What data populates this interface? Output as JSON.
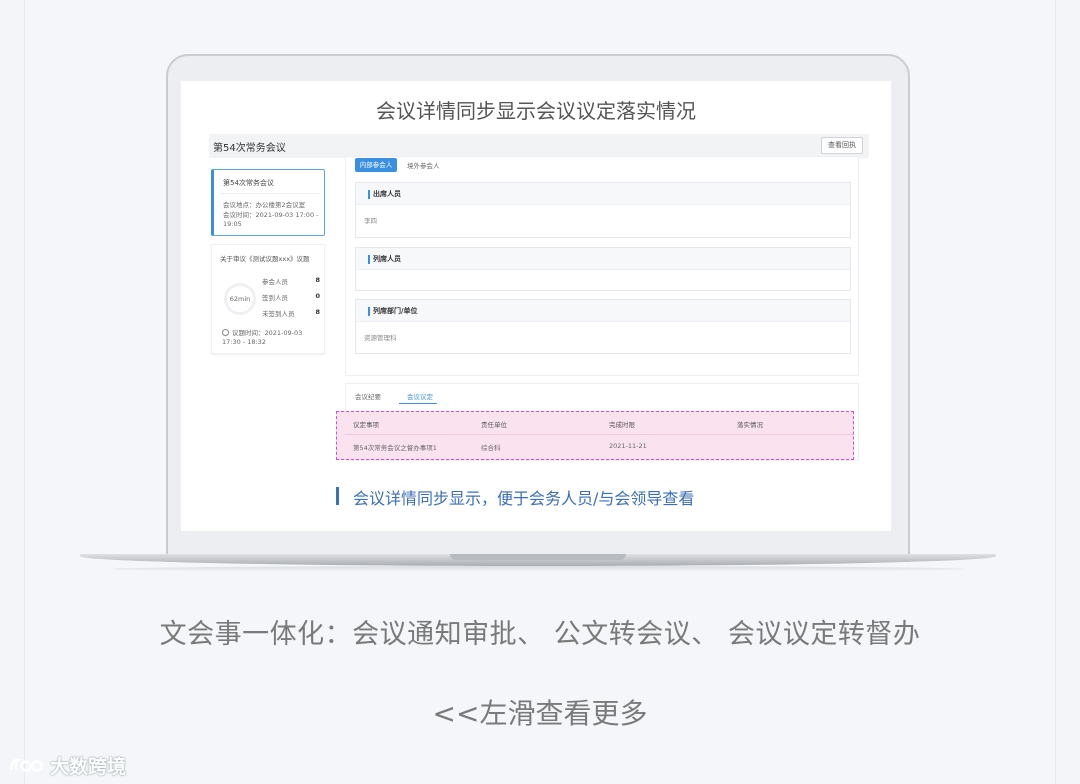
{
  "screen": {
    "title": "会议详情同步显示会议议定落实情况",
    "meeting_name": "第54次常务会议",
    "receipt_button": "查看回执",
    "info_card": {
      "title": "第54次常务会议",
      "location": "会议地点：办公楼第2会议室",
      "time": "会议时间：2021-09-03 17:00 - 19:05"
    },
    "topic_card": {
      "title": "关于审议《测试议题xxx》议题",
      "duration": "62min",
      "stats": [
        {
          "label": "参会人员",
          "value": "8"
        },
        {
          "label": "签到人员",
          "value": "0"
        },
        {
          "label": "未签到人员",
          "value": "8"
        }
      ],
      "vote_time": "议题时间：2021-09-03 17:30 - 18:32"
    },
    "tabs": {
      "active": "内部参会人",
      "inactive": "境外参会人"
    },
    "sections": [
      {
        "title": "出席人员",
        "content": "李四"
      },
      {
        "title": "列席人员",
        "content": ""
      },
      {
        "title": "列席部门/单位",
        "content": "资源管理科"
      }
    ],
    "bottom_tabs": {
      "tab1": "会议纪要",
      "tab2": "会议议定"
    },
    "table": {
      "headers": [
        "议定事项",
        "责任单位",
        "完成时限",
        "落实情况"
      ],
      "row": [
        "第54次常务会议之督办事项1",
        "综合科",
        "2021-11-21",
        ""
      ]
    },
    "caption": "会议详情同步显示，便于会务人员/与会领导查看"
  },
  "subtitle": "文会事一体化：会议通知审批、 公文转会议、 会议议定转督办",
  "swipe_hint": "<<左滑查看更多",
  "watermark": "大数跨境",
  "colors": {
    "accent": "#3b8fe0",
    "highlight_border": "#d64ec8",
    "highlight_fill": "#fbe2ef",
    "caption": "#3b6fb8"
  }
}
